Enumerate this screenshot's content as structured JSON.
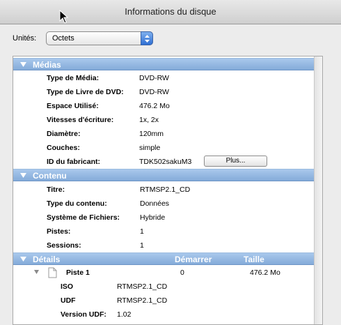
{
  "window": {
    "title": "Informations du disque"
  },
  "units": {
    "label": "Unités:",
    "selected": "Octets"
  },
  "media": {
    "header": "Médias",
    "rows": [
      {
        "key": "Type de Média:",
        "value": "DVD-RW"
      },
      {
        "key": "Type de Livre de DVD:",
        "value": "DVD-RW"
      },
      {
        "key": "Espace Utilisé:",
        "value": "476.2 Mo"
      },
      {
        "key": "Vitesses d'écriture:",
        "value": "1x, 2x"
      },
      {
        "key": "Diamètre:",
        "value": "120mm"
      },
      {
        "key": "Couches:",
        "value": "simple"
      },
      {
        "key": "ID du fabricant:",
        "value": "TDK502sakuM3"
      }
    ],
    "more_button": "Plus..."
  },
  "content": {
    "header": "Contenu",
    "rows": [
      {
        "key": "Titre:",
        "value": "RTMSP2.1_CD"
      },
      {
        "key": "Type du contenu:",
        "value": "Données"
      },
      {
        "key": "Système de Fichiers:",
        "value": "Hybride"
      },
      {
        "key": "Pistes:",
        "value": "1"
      },
      {
        "key": "Sessions:",
        "value": "1"
      }
    ]
  },
  "details": {
    "header": "Détails",
    "col_start": "Démarrer",
    "col_size": "Taille",
    "track": {
      "name": "Piste 1",
      "start": "0",
      "size": "476.2 Mo"
    },
    "sub": [
      {
        "key": "ISO",
        "value": "RTMSP2.1_CD"
      },
      {
        "key": "UDF",
        "value": "RTMSP2.1_CD"
      },
      {
        "key": "Version UDF:",
        "value": "1.02"
      }
    ]
  },
  "icons": [
    "mouse-cursor-icon",
    "stepper-arrows-icon",
    "disclosure-triangle-icon",
    "document-icon"
  ],
  "colors": {
    "section_header": "#94b8e3",
    "select_stepper": "#2f6fd3"
  }
}
